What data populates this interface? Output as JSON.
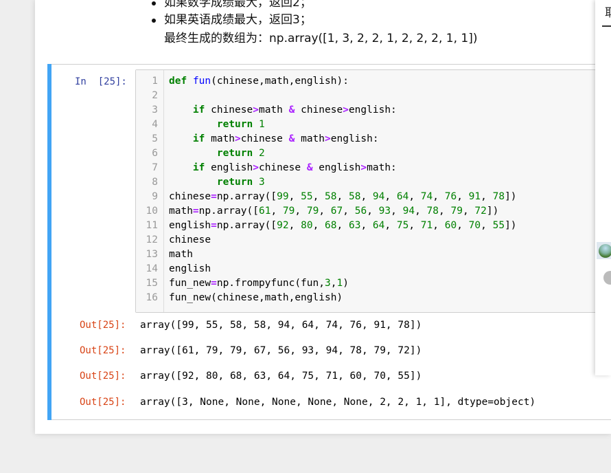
{
  "markdown": {
    "bullets": [
      "如果数学成绩最大，返回2；",
      "如果英语成绩最大，返回3；"
    ],
    "final_line": "最终生成的数组为：np.array([1, 3, 2, 2, 1, 2, 2, 2, 1, 1])"
  },
  "code_cell": {
    "in_prompt": "In  [25]:",
    "line_numbers": [
      "1",
      "2",
      "3",
      "4",
      "5",
      "6",
      "7",
      "8",
      "9",
      "10",
      "11",
      "12",
      "13",
      "14",
      "15",
      "16"
    ],
    "outputs": [
      {
        "prompt": "Out[25]:",
        "text": "array([99, 55, 58, 58, 94, 64, 74, 76, 91, 78])"
      },
      {
        "prompt": "Out[25]:",
        "text": "array([61, 79, 79, 67, 56, 93, 94, 78, 79, 72])"
      },
      {
        "prompt": "Out[25]:",
        "text": "array([92, 80, 68, 63, 64, 75, 71, 60, 70, 55])"
      },
      {
        "prompt": "Out[25]:",
        "text": "array([3, None, None, None, None, None, 2, 2, 1, 1], dtype=object)"
      }
    ]
  },
  "code_lines": [
    [
      {
        "t": "def",
        "c": "kw"
      },
      {
        "t": " "
      },
      {
        "t": "fun",
        "c": "fn"
      },
      {
        "t": "(chinese,math,english):"
      }
    ],
    [],
    [
      {
        "t": "    "
      },
      {
        "t": "if",
        "c": "kw"
      },
      {
        "t": " chinese"
      },
      {
        "t": ">",
        "c": "op"
      },
      {
        "t": "math "
      },
      {
        "t": "&",
        "c": "op"
      },
      {
        "t": " chinese"
      },
      {
        "t": ">",
        "c": "op"
      },
      {
        "t": "english:"
      }
    ],
    [
      {
        "t": "        "
      },
      {
        "t": "return",
        "c": "kw"
      },
      {
        "t": " "
      },
      {
        "t": "1",
        "c": "num"
      }
    ],
    [
      {
        "t": "    "
      },
      {
        "t": "if",
        "c": "kw"
      },
      {
        "t": " math"
      },
      {
        "t": ">",
        "c": "op"
      },
      {
        "t": "chinese "
      },
      {
        "t": "&",
        "c": "op"
      },
      {
        "t": " math"
      },
      {
        "t": ">",
        "c": "op"
      },
      {
        "t": "english:"
      }
    ],
    [
      {
        "t": "        "
      },
      {
        "t": "return",
        "c": "kw"
      },
      {
        "t": " "
      },
      {
        "t": "2",
        "c": "num"
      }
    ],
    [
      {
        "t": "    "
      },
      {
        "t": "if",
        "c": "kw"
      },
      {
        "t": " english"
      },
      {
        "t": ">",
        "c": "op"
      },
      {
        "t": "chinese "
      },
      {
        "t": "&",
        "c": "op"
      },
      {
        "t": " english"
      },
      {
        "t": ">",
        "c": "op"
      },
      {
        "t": "math:"
      }
    ],
    [
      {
        "t": "        "
      },
      {
        "t": "return",
        "c": "kw"
      },
      {
        "t": " "
      },
      {
        "t": "3",
        "c": "num"
      }
    ],
    [
      {
        "t": "chinese"
      },
      {
        "t": "=",
        "c": "op"
      },
      {
        "t": "np.array(["
      },
      {
        "t": "99",
        "c": "num"
      },
      {
        "t": ", "
      },
      {
        "t": "55",
        "c": "num"
      },
      {
        "t": ", "
      },
      {
        "t": "58",
        "c": "num"
      },
      {
        "t": ", "
      },
      {
        "t": "58",
        "c": "num"
      },
      {
        "t": ", "
      },
      {
        "t": "94",
        "c": "num"
      },
      {
        "t": ", "
      },
      {
        "t": "64",
        "c": "num"
      },
      {
        "t": ", "
      },
      {
        "t": "74",
        "c": "num"
      },
      {
        "t": ", "
      },
      {
        "t": "76",
        "c": "num"
      },
      {
        "t": ", "
      },
      {
        "t": "91",
        "c": "num"
      },
      {
        "t": ", "
      },
      {
        "t": "78",
        "c": "num"
      },
      {
        "t": "])"
      }
    ],
    [
      {
        "t": "math"
      },
      {
        "t": "=",
        "c": "op"
      },
      {
        "t": "np.array(["
      },
      {
        "t": "61",
        "c": "num"
      },
      {
        "t": ", "
      },
      {
        "t": "79",
        "c": "num"
      },
      {
        "t": ", "
      },
      {
        "t": "79",
        "c": "num"
      },
      {
        "t": ", "
      },
      {
        "t": "67",
        "c": "num"
      },
      {
        "t": ", "
      },
      {
        "t": "56",
        "c": "num"
      },
      {
        "t": ", "
      },
      {
        "t": "93",
        "c": "num"
      },
      {
        "t": ", "
      },
      {
        "t": "94",
        "c": "num"
      },
      {
        "t": ", "
      },
      {
        "t": "78",
        "c": "num"
      },
      {
        "t": ", "
      },
      {
        "t": "79",
        "c": "num"
      },
      {
        "t": ", "
      },
      {
        "t": "72",
        "c": "num"
      },
      {
        "t": "])"
      }
    ],
    [
      {
        "t": "english"
      },
      {
        "t": "=",
        "c": "op"
      },
      {
        "t": "np.array(["
      },
      {
        "t": "92",
        "c": "num"
      },
      {
        "t": ", "
      },
      {
        "t": "80",
        "c": "num"
      },
      {
        "t": ", "
      },
      {
        "t": "68",
        "c": "num"
      },
      {
        "t": ", "
      },
      {
        "t": "63",
        "c": "num"
      },
      {
        "t": ", "
      },
      {
        "t": "64",
        "c": "num"
      },
      {
        "t": ", "
      },
      {
        "t": "75",
        "c": "num"
      },
      {
        "t": ", "
      },
      {
        "t": "71",
        "c": "num"
      },
      {
        "t": ", "
      },
      {
        "t": "60",
        "c": "num"
      },
      {
        "t": ", "
      },
      {
        "t": "70",
        "c": "num"
      },
      {
        "t": ", "
      },
      {
        "t": "55",
        "c": "num"
      },
      {
        "t": "])"
      }
    ],
    [
      {
        "t": "chinese"
      }
    ],
    [
      {
        "t": "math"
      }
    ],
    [
      {
        "t": "english"
      }
    ],
    [
      {
        "t": "fun_new"
      },
      {
        "t": "=",
        "c": "op"
      },
      {
        "t": "np.frompyfunc(fun,"
      },
      {
        "t": "3",
        "c": "num"
      },
      {
        "t": ","
      },
      {
        "t": "1",
        "c": "num"
      },
      {
        "t": ")"
      }
    ],
    [
      {
        "t": "fun_new(chinese,math,english)"
      }
    ]
  ],
  "right_panel": {
    "tab_char": "耶",
    "avatar": "avatar-image",
    "user_icon": "user-icon"
  },
  "colors": {
    "selection_bar": "#42a5f5",
    "in_prompt": "#303f9f",
    "out_prompt": "#d84315",
    "keyword": "#008000",
    "function_name": "#0000ff",
    "operator": "#aa22ff",
    "number": "#008000"
  }
}
